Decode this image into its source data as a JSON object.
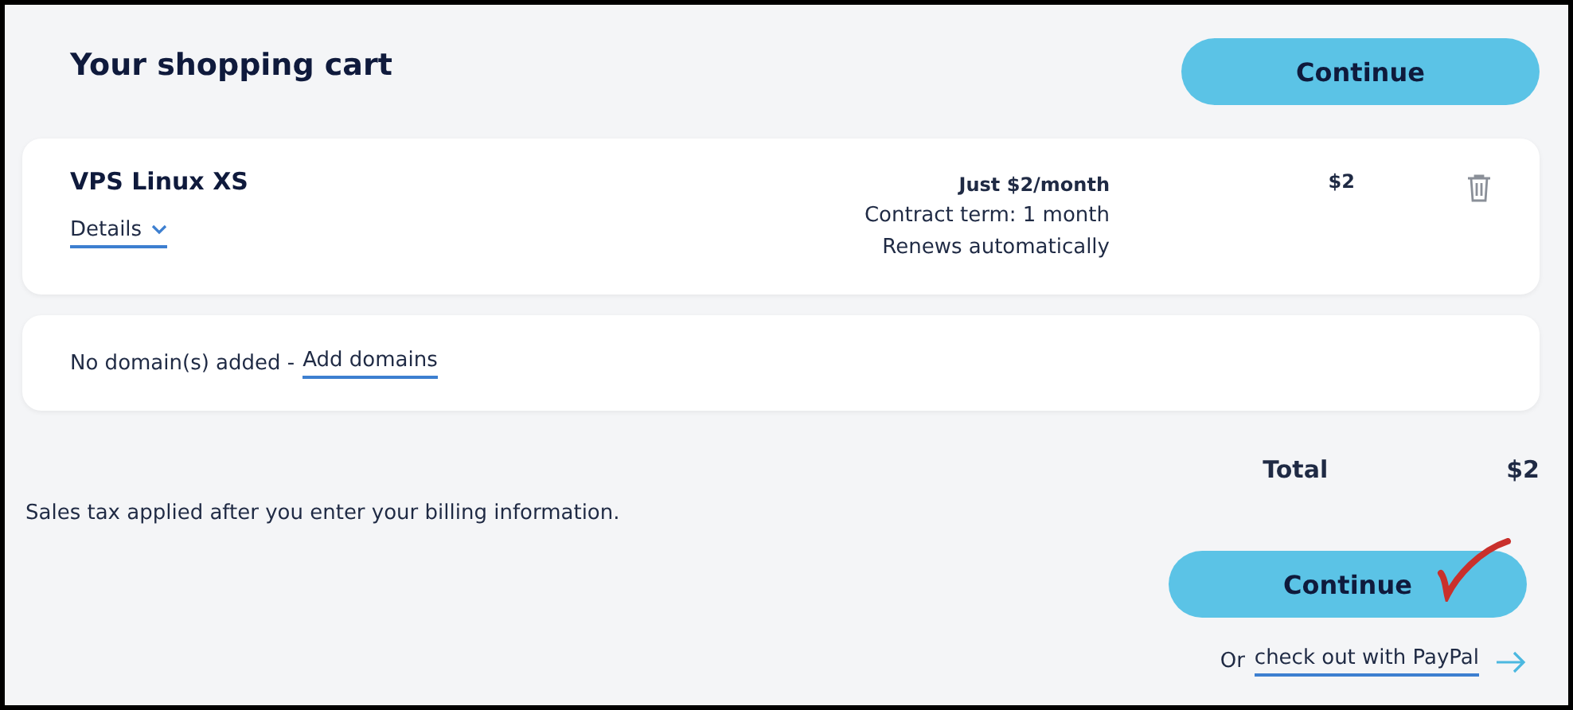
{
  "header": {
    "title": "Your shopping cart",
    "button": "Continue"
  },
  "item": {
    "name": "VPS Linux XS",
    "details_link": "Details",
    "price_lines": [
      "Just $2/month",
      "Contract term: 1 month",
      "Renews automatically"
    ],
    "price": "$2"
  },
  "domains": {
    "text": "No domain(s) added - ",
    "link": "Add domains"
  },
  "summary": {
    "total_label": "Total",
    "total_value": "$2",
    "tax_note": "Sales tax applied after you enter your billing information.",
    "button": "Continue",
    "paypal_prefix": "Or ",
    "paypal_link": "check out with PayPal"
  }
}
